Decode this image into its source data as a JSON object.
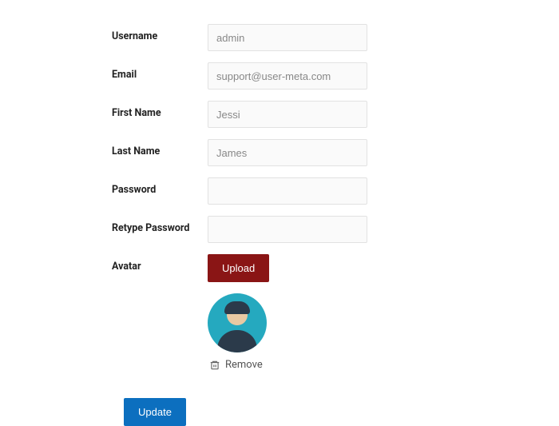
{
  "form": {
    "username": {
      "label": "Username",
      "value": "admin"
    },
    "email": {
      "label": "Email",
      "value": "support@user-meta.com"
    },
    "first_name": {
      "label": "First Name",
      "value": "Jessi"
    },
    "last_name": {
      "label": "Last Name",
      "value": "James"
    },
    "password": {
      "label": "Password",
      "value": ""
    },
    "retype_password": {
      "label": "Retype Password",
      "value": ""
    },
    "avatar": {
      "label": "Avatar",
      "upload_label": "Upload",
      "remove_label": "Remove"
    }
  },
  "actions": {
    "submit_label": "Update"
  }
}
